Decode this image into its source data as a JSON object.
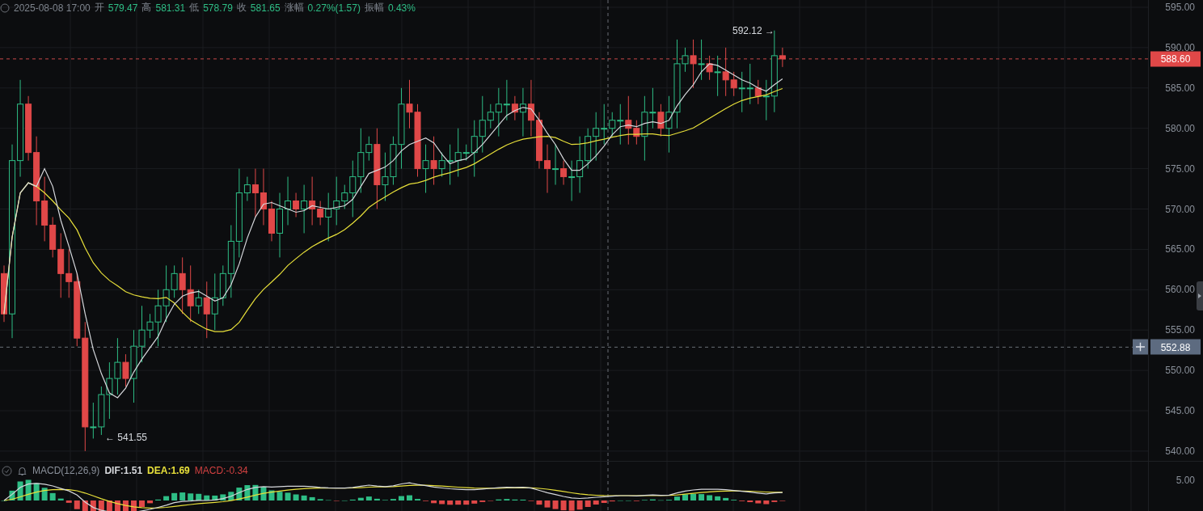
{
  "header": {
    "date": "2025-08-08 17:00",
    "open_label": "开",
    "open": "579.47",
    "high_label": "高",
    "high": "581.31",
    "low_label": "低",
    "low": "578.79",
    "close_label": "收",
    "close": "581.65",
    "change_label": "涨幅",
    "change": "0.27%(1.57)",
    "amplitude_label": "振幅",
    "amplitude": "0.43%"
  },
  "price_axis": {
    "ticks": [
      "595.00",
      "590.00",
      "585.00",
      "580.00",
      "575.00",
      "570.00",
      "565.00",
      "560.00",
      "555.00",
      "550.00",
      "545.00",
      "540.00"
    ],
    "last_price": "588.60",
    "crosshair_price": "552.88"
  },
  "markers": {
    "high": "592.12 →",
    "low": "← 541.55"
  },
  "macd": {
    "title": "MACD(12,26,9)",
    "dif": "DIF:1.51",
    "dea": "DEA:1.69",
    "macd": "MACD:-0.34",
    "axis_tick": "5.00"
  }
}
